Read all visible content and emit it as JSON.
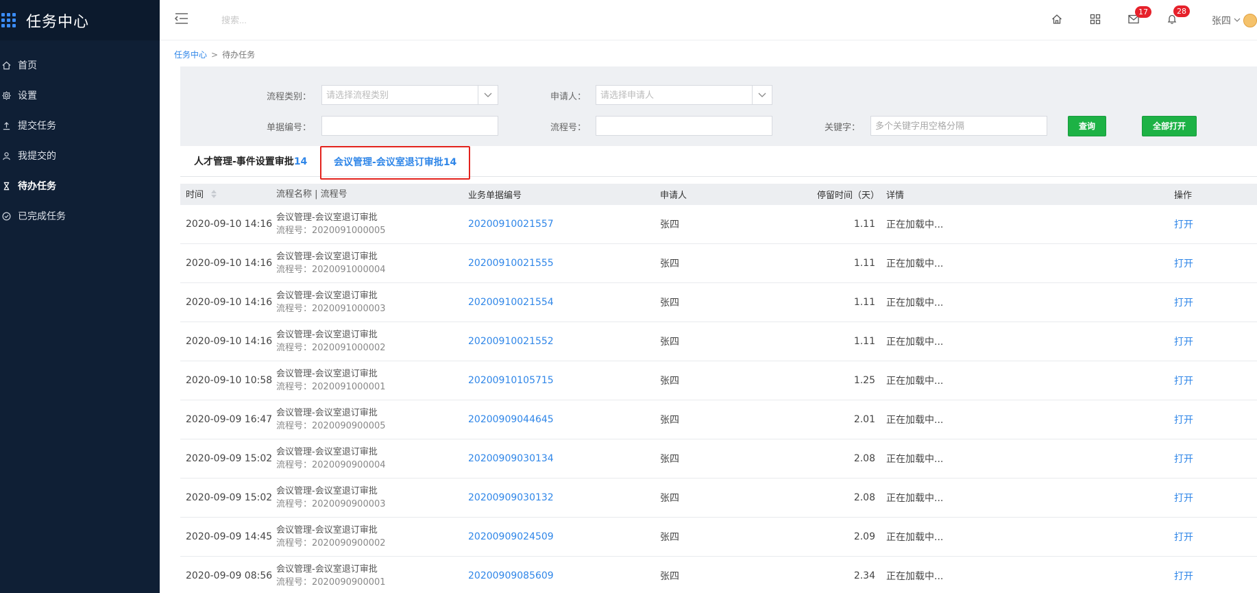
{
  "app": {
    "title": "任务中心"
  },
  "sidebar": {
    "items": [
      {
        "label": "首页",
        "icon": "home-icon",
        "active": false
      },
      {
        "label": "设置",
        "icon": "gear-icon",
        "active": false
      },
      {
        "label": "提交任务",
        "icon": "upload-icon",
        "active": false
      },
      {
        "label": "我提交的",
        "icon": "user-icon",
        "active": false
      },
      {
        "label": "待办任务",
        "icon": "hourglass-icon",
        "active": true
      },
      {
        "label": "已完成任务",
        "icon": "check-circle-icon",
        "active": false
      }
    ]
  },
  "header": {
    "search_placeholder": "搜索...",
    "mail_count": "17",
    "bell_count": "28",
    "user_name": "张四"
  },
  "breadcrumb": {
    "root": "任务中心",
    "separator": ">",
    "current": "待办任务"
  },
  "filters": {
    "category_label": "流程类别：",
    "category_placeholder": "请选择流程类别",
    "applicant_label": "申请人：",
    "applicant_placeholder": "请选择申请人",
    "doc_label": "单据编号：",
    "flow_label": "流程号：",
    "keyword_label": "关键字：",
    "keyword_placeholder": "多个关键字用空格分隔",
    "query_button": "查询",
    "open_all_button": "全部打开"
  },
  "tabs": [
    {
      "label": "人才管理-事件设置审批",
      "count": "14"
    },
    {
      "label": "会议管理-会议室退订审批",
      "count": "14"
    }
  ],
  "table": {
    "headers": {
      "time": "时间",
      "name": "流程名称 | 流程号",
      "doc": "业务单据编号",
      "applicant": "申请人",
      "stay": "停留时间（天）",
      "detail": "详情",
      "op": "操作"
    },
    "rows": [
      {
        "time": "2020-09-10 14:16",
        "name": "会议管理-会议室退订审批",
        "flow": "流程号：2020091000005",
        "doc": "20200910021557",
        "applicant": "张四",
        "stay": "1.11",
        "detail": "正在加载中...",
        "op": "打开"
      },
      {
        "time": "2020-09-10 14:16",
        "name": "会议管理-会议室退订审批",
        "flow": "流程号：2020091000004",
        "doc": "20200910021555",
        "applicant": "张四",
        "stay": "1.11",
        "detail": "正在加载中...",
        "op": "打开"
      },
      {
        "time": "2020-09-10 14:16",
        "name": "会议管理-会议室退订审批",
        "flow": "流程号：2020091000003",
        "doc": "20200910021554",
        "applicant": "张四",
        "stay": "1.11",
        "detail": "正在加载中...",
        "op": "打开"
      },
      {
        "time": "2020-09-10 14:16",
        "name": "会议管理-会议室退订审批",
        "flow": "流程号：2020091000002",
        "doc": "20200910021552",
        "applicant": "张四",
        "stay": "1.11",
        "detail": "正在加载中...",
        "op": "打开"
      },
      {
        "time": "2020-09-10 10:58",
        "name": "会议管理-会议室退订审批",
        "flow": "流程号：2020091000001",
        "doc": "20200910105715",
        "applicant": "张四",
        "stay": "1.25",
        "detail": "正在加载中...",
        "op": "打开"
      },
      {
        "time": "2020-09-09 16:47",
        "name": "会议管理-会议室退订审批",
        "flow": "流程号：2020090900005",
        "doc": "20200909044645",
        "applicant": "张四",
        "stay": "2.01",
        "detail": "正在加载中...",
        "op": "打开"
      },
      {
        "time": "2020-09-09 15:02",
        "name": "会议管理-会议室退订审批",
        "flow": "流程号：2020090900004",
        "doc": "20200909030134",
        "applicant": "张四",
        "stay": "2.08",
        "detail": "正在加载中...",
        "op": "打开"
      },
      {
        "time": "2020-09-09 15:02",
        "name": "会议管理-会议室退订审批",
        "flow": "流程号：2020090900003",
        "doc": "20200909030132",
        "applicant": "张四",
        "stay": "2.08",
        "detail": "正在加载中...",
        "op": "打开"
      },
      {
        "time": "2020-09-09 14:45",
        "name": "会议管理-会议室退订审批",
        "flow": "流程号：2020090900002",
        "doc": "20200909024509",
        "applicant": "张四",
        "stay": "2.09",
        "detail": "正在加载中...",
        "op": "打开"
      },
      {
        "time": "2020-09-09 08:56",
        "name": "会议管理-会议室退订审批",
        "flow": "流程号：2020090900001",
        "doc": "20200909085609",
        "applicant": "张四",
        "stay": "2.34",
        "detail": "正在加载中...",
        "op": "打开"
      }
    ]
  },
  "colors": {
    "sidebar_bg": "#0f1f35",
    "accent_blue": "#2f86e8",
    "button_green": "#1db245",
    "badge_red": "#e6212b",
    "highlight_red": "#e3221c"
  }
}
